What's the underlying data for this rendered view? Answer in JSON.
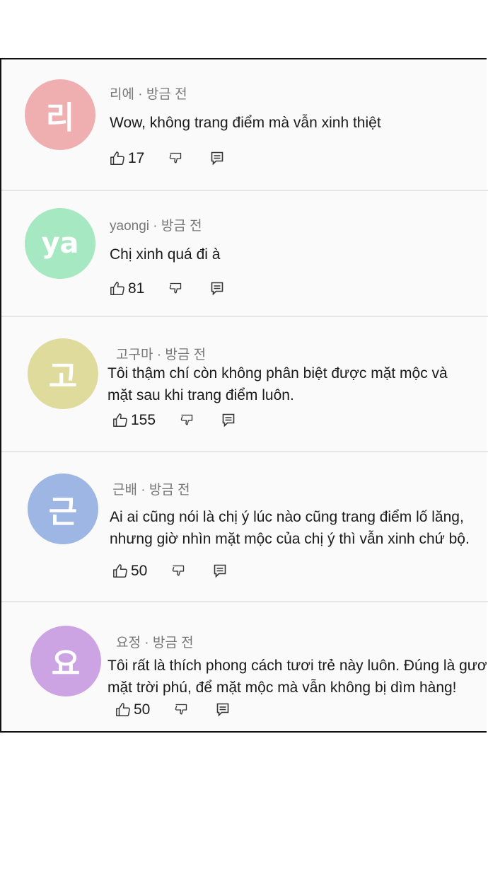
{
  "comments": [
    {
      "username": "리에",
      "time": "방금 전",
      "avatar_letter": "리",
      "avatar_color": "#efafb0",
      "text": [
        "Wow, không trang điểm mà vẫn xinh thiệt"
      ],
      "likes": "17"
    },
    {
      "username": "yaongi",
      "time": "방금 전",
      "avatar_letter": "ya",
      "avatar_color": "#a6e8c1",
      "text": [
        "Chị xinh quá đi à"
      ],
      "likes": "81"
    },
    {
      "username": "고구마",
      "time": "방금 전",
      "avatar_letter": "고",
      "avatar_color": "#dedb9c",
      "text": [
        "Tôi thậm chí còn không phân biệt được mặt mộc và",
        "mặt sau khi trang điểm luôn."
      ],
      "likes": "155"
    },
    {
      "username": "근배",
      "time": "방금 전",
      "avatar_letter": "근",
      "avatar_color": "#9eb6e3",
      "text": [
        "Ai ai cũng nói là chị ý lúc nào cũng trang điểm lố lăng,",
        "nhưng giờ nhìn mặt mộc của chị ý thì vẫn xinh chứ bộ."
      ],
      "likes": "50"
    },
    {
      "username": "요정",
      "time": "방금 전",
      "avatar_letter": "요",
      "avatar_color": "#cca3e3",
      "text": [
        "Tôi rất là thích phong cách tươi trẻ này luôn. Đúng là gương",
        "mặt trời phú, để mặt mộc mà vẫn không bị dìm hàng!"
      ],
      "likes": "50"
    }
  ],
  "icons": {
    "like": "thumbs-up-icon",
    "dislike": "thumbs-down-icon",
    "reply": "reply-icon"
  }
}
